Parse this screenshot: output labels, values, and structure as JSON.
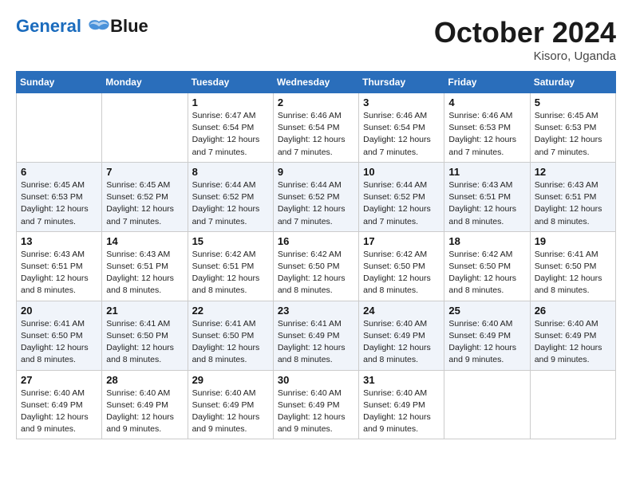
{
  "header": {
    "logo_line1": "General",
    "logo_line2": "Blue",
    "month": "October 2024",
    "location": "Kisoro, Uganda"
  },
  "days_of_week": [
    "Sunday",
    "Monday",
    "Tuesday",
    "Wednesday",
    "Thursday",
    "Friday",
    "Saturday"
  ],
  "weeks": [
    [
      {
        "num": "",
        "info": ""
      },
      {
        "num": "",
        "info": ""
      },
      {
        "num": "1",
        "info": "Sunrise: 6:47 AM\nSunset: 6:54 PM\nDaylight: 12 hours and 7 minutes."
      },
      {
        "num": "2",
        "info": "Sunrise: 6:46 AM\nSunset: 6:54 PM\nDaylight: 12 hours and 7 minutes."
      },
      {
        "num": "3",
        "info": "Sunrise: 6:46 AM\nSunset: 6:54 PM\nDaylight: 12 hours and 7 minutes."
      },
      {
        "num": "4",
        "info": "Sunrise: 6:46 AM\nSunset: 6:53 PM\nDaylight: 12 hours and 7 minutes."
      },
      {
        "num": "5",
        "info": "Sunrise: 6:45 AM\nSunset: 6:53 PM\nDaylight: 12 hours and 7 minutes."
      }
    ],
    [
      {
        "num": "6",
        "info": "Sunrise: 6:45 AM\nSunset: 6:53 PM\nDaylight: 12 hours and 7 minutes."
      },
      {
        "num": "7",
        "info": "Sunrise: 6:45 AM\nSunset: 6:52 PM\nDaylight: 12 hours and 7 minutes."
      },
      {
        "num": "8",
        "info": "Sunrise: 6:44 AM\nSunset: 6:52 PM\nDaylight: 12 hours and 7 minutes."
      },
      {
        "num": "9",
        "info": "Sunrise: 6:44 AM\nSunset: 6:52 PM\nDaylight: 12 hours and 7 minutes."
      },
      {
        "num": "10",
        "info": "Sunrise: 6:44 AM\nSunset: 6:52 PM\nDaylight: 12 hours and 7 minutes."
      },
      {
        "num": "11",
        "info": "Sunrise: 6:43 AM\nSunset: 6:51 PM\nDaylight: 12 hours and 8 minutes."
      },
      {
        "num": "12",
        "info": "Sunrise: 6:43 AM\nSunset: 6:51 PM\nDaylight: 12 hours and 8 minutes."
      }
    ],
    [
      {
        "num": "13",
        "info": "Sunrise: 6:43 AM\nSunset: 6:51 PM\nDaylight: 12 hours and 8 minutes."
      },
      {
        "num": "14",
        "info": "Sunrise: 6:43 AM\nSunset: 6:51 PM\nDaylight: 12 hours and 8 minutes."
      },
      {
        "num": "15",
        "info": "Sunrise: 6:42 AM\nSunset: 6:51 PM\nDaylight: 12 hours and 8 minutes."
      },
      {
        "num": "16",
        "info": "Sunrise: 6:42 AM\nSunset: 6:50 PM\nDaylight: 12 hours and 8 minutes."
      },
      {
        "num": "17",
        "info": "Sunrise: 6:42 AM\nSunset: 6:50 PM\nDaylight: 12 hours and 8 minutes."
      },
      {
        "num": "18",
        "info": "Sunrise: 6:42 AM\nSunset: 6:50 PM\nDaylight: 12 hours and 8 minutes."
      },
      {
        "num": "19",
        "info": "Sunrise: 6:41 AM\nSunset: 6:50 PM\nDaylight: 12 hours and 8 minutes."
      }
    ],
    [
      {
        "num": "20",
        "info": "Sunrise: 6:41 AM\nSunset: 6:50 PM\nDaylight: 12 hours and 8 minutes."
      },
      {
        "num": "21",
        "info": "Sunrise: 6:41 AM\nSunset: 6:50 PM\nDaylight: 12 hours and 8 minutes."
      },
      {
        "num": "22",
        "info": "Sunrise: 6:41 AM\nSunset: 6:50 PM\nDaylight: 12 hours and 8 minutes."
      },
      {
        "num": "23",
        "info": "Sunrise: 6:41 AM\nSunset: 6:49 PM\nDaylight: 12 hours and 8 minutes."
      },
      {
        "num": "24",
        "info": "Sunrise: 6:40 AM\nSunset: 6:49 PM\nDaylight: 12 hours and 8 minutes."
      },
      {
        "num": "25",
        "info": "Sunrise: 6:40 AM\nSunset: 6:49 PM\nDaylight: 12 hours and 9 minutes."
      },
      {
        "num": "26",
        "info": "Sunrise: 6:40 AM\nSunset: 6:49 PM\nDaylight: 12 hours and 9 minutes."
      }
    ],
    [
      {
        "num": "27",
        "info": "Sunrise: 6:40 AM\nSunset: 6:49 PM\nDaylight: 12 hours and 9 minutes."
      },
      {
        "num": "28",
        "info": "Sunrise: 6:40 AM\nSunset: 6:49 PM\nDaylight: 12 hours and 9 minutes."
      },
      {
        "num": "29",
        "info": "Sunrise: 6:40 AM\nSunset: 6:49 PM\nDaylight: 12 hours and 9 minutes."
      },
      {
        "num": "30",
        "info": "Sunrise: 6:40 AM\nSunset: 6:49 PM\nDaylight: 12 hours and 9 minutes."
      },
      {
        "num": "31",
        "info": "Sunrise: 6:40 AM\nSunset: 6:49 PM\nDaylight: 12 hours and 9 minutes."
      },
      {
        "num": "",
        "info": ""
      },
      {
        "num": "",
        "info": ""
      }
    ]
  ]
}
